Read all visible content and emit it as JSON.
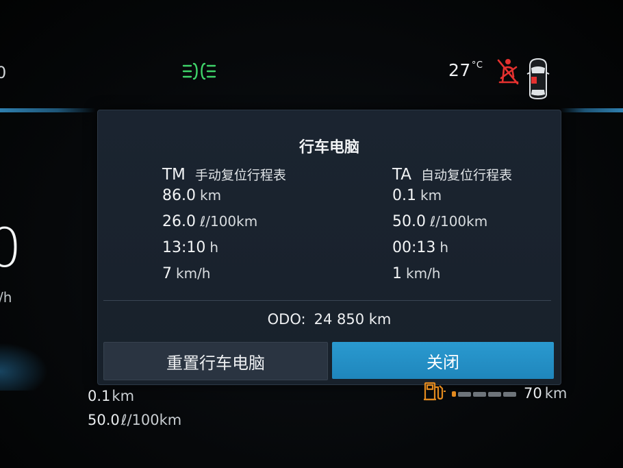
{
  "status_bar": {
    "left_fragment": "0",
    "temperature": "27",
    "temperature_unit": "°C",
    "icons": [
      "headlight-icon",
      "seatbelt-warning-icon",
      "car-doors-icon"
    ],
    "colors": {
      "headlight": "#3fd46a",
      "seatbelt": "#e5312f"
    }
  },
  "left_gauge": {
    "speed_fragment": "0",
    "unit_fragment": "/h"
  },
  "trip_computer": {
    "title": "行车电脑",
    "tm": {
      "code": "TM",
      "name": "手动复位行程表",
      "distance": {
        "value": "86.0",
        "unit": "km"
      },
      "consumption": {
        "value": "26.0",
        "unit": "ℓ/100km"
      },
      "time": {
        "value": "13:10",
        "unit": "h"
      },
      "speed": {
        "value": "7",
        "unit": "km/h"
      }
    },
    "ta": {
      "code": "TA",
      "name": "自动复位行程表",
      "distance": {
        "value": "0.1",
        "unit": "km"
      },
      "consumption": {
        "value": "50.0",
        "unit": "ℓ/100km"
      },
      "time": {
        "value": "00:13",
        "unit": "h"
      },
      "speed": {
        "value": "1",
        "unit": "km/h"
      }
    },
    "odo": {
      "label": "ODO:",
      "value": "24 850 km"
    },
    "buttons": {
      "reset_label": "重置行车电脑",
      "close_label": "关闭"
    },
    "accent_color": "#2496cc"
  },
  "bottom": {
    "trip_distance": {
      "value": "0.1",
      "unit": "km"
    },
    "trip_consumption": {
      "value": "50.0",
      "unit": "ℓ/100km"
    },
    "fuel": {
      "level_fraction": 0.05,
      "icon": "fuel-pump-icon",
      "warning_color": "#e38a1e"
    },
    "range": {
      "value": "70",
      "unit": "km"
    }
  }
}
